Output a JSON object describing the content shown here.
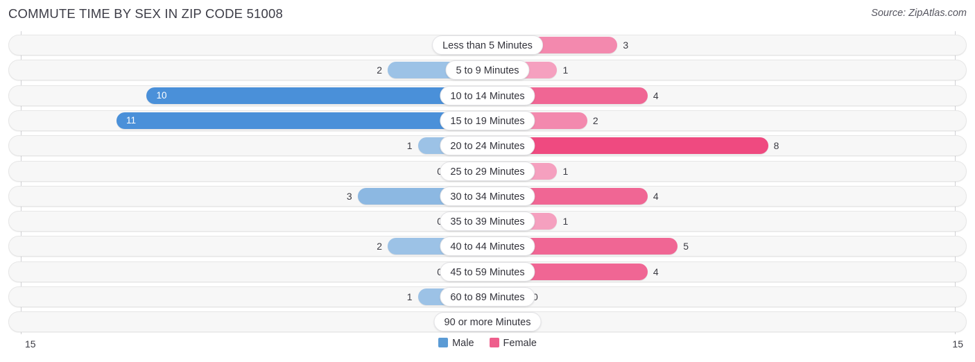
{
  "header": {
    "title": "COMMUTE TIME BY SEX IN ZIP CODE 51008",
    "source": "Source: ZipAtlas.com"
  },
  "legend": {
    "items": [
      {
        "label": "Male",
        "color": "#5b9bd5"
      },
      {
        "label": "Female",
        "color": "#ee5e8c"
      }
    ]
  },
  "axis": {
    "left_label": "15",
    "right_label": "15"
  },
  "chart_data": {
    "type": "bar",
    "orientation": "horizontal",
    "style": "diverging-bidirectional",
    "title": "COMMUTE TIME BY SEX IN ZIP CODE 51008",
    "xlabel": "",
    "ylabel": "",
    "xlim": [
      -15,
      15
    ],
    "axis_max": 15,
    "grid": false,
    "legend_position": "bottom-center",
    "categories": [
      "Less than 5 Minutes",
      "5 to 9 Minutes",
      "10 to 14 Minutes",
      "15 to 19 Minutes",
      "20 to 24 Minutes",
      "25 to 29 Minutes",
      "30 to 34 Minutes",
      "35 to 39 Minutes",
      "40 to 44 Minutes",
      "45 to 59 Minutes",
      "60 to 89 Minutes",
      "90 or more Minutes"
    ],
    "series": [
      {
        "name": "Male",
        "direction": "left",
        "color": "#5b9bd5",
        "values": [
          0,
          2,
          10,
          11,
          1,
          0,
          3,
          0,
          2,
          0,
          1,
          0
        ]
      },
      {
        "name": "Female",
        "direction": "right",
        "color": "#ee5e8c",
        "values": [
          3,
          1,
          4,
          2,
          8,
          1,
          4,
          1,
          5,
          4,
          0,
          0
        ]
      }
    ]
  },
  "rows": [
    {
      "category": "Less than 5 Minutes",
      "male": 0,
      "female": 3
    },
    {
      "category": "5 to 9 Minutes",
      "male": 2,
      "female": 1
    },
    {
      "category": "10 to 14 Minutes",
      "male": 10,
      "female": 4
    },
    {
      "category": "15 to 19 Minutes",
      "male": 11,
      "female": 2
    },
    {
      "category": "20 to 24 Minutes",
      "male": 1,
      "female": 8
    },
    {
      "category": "25 to 29 Minutes",
      "male": 0,
      "female": 1
    },
    {
      "category": "30 to 34 Minutes",
      "male": 3,
      "female": 4
    },
    {
      "category": "35 to 39 Minutes",
      "male": 0,
      "female": 1
    },
    {
      "category": "40 to 44 Minutes",
      "male": 2,
      "female": 5
    },
    {
      "category": "45 to 59 Minutes",
      "male": 0,
      "female": 4
    },
    {
      "category": "60 to 89 Minutes",
      "male": 1,
      "female": 0
    },
    {
      "category": "90 or more Minutes",
      "male": 0,
      "female": 0
    }
  ]
}
